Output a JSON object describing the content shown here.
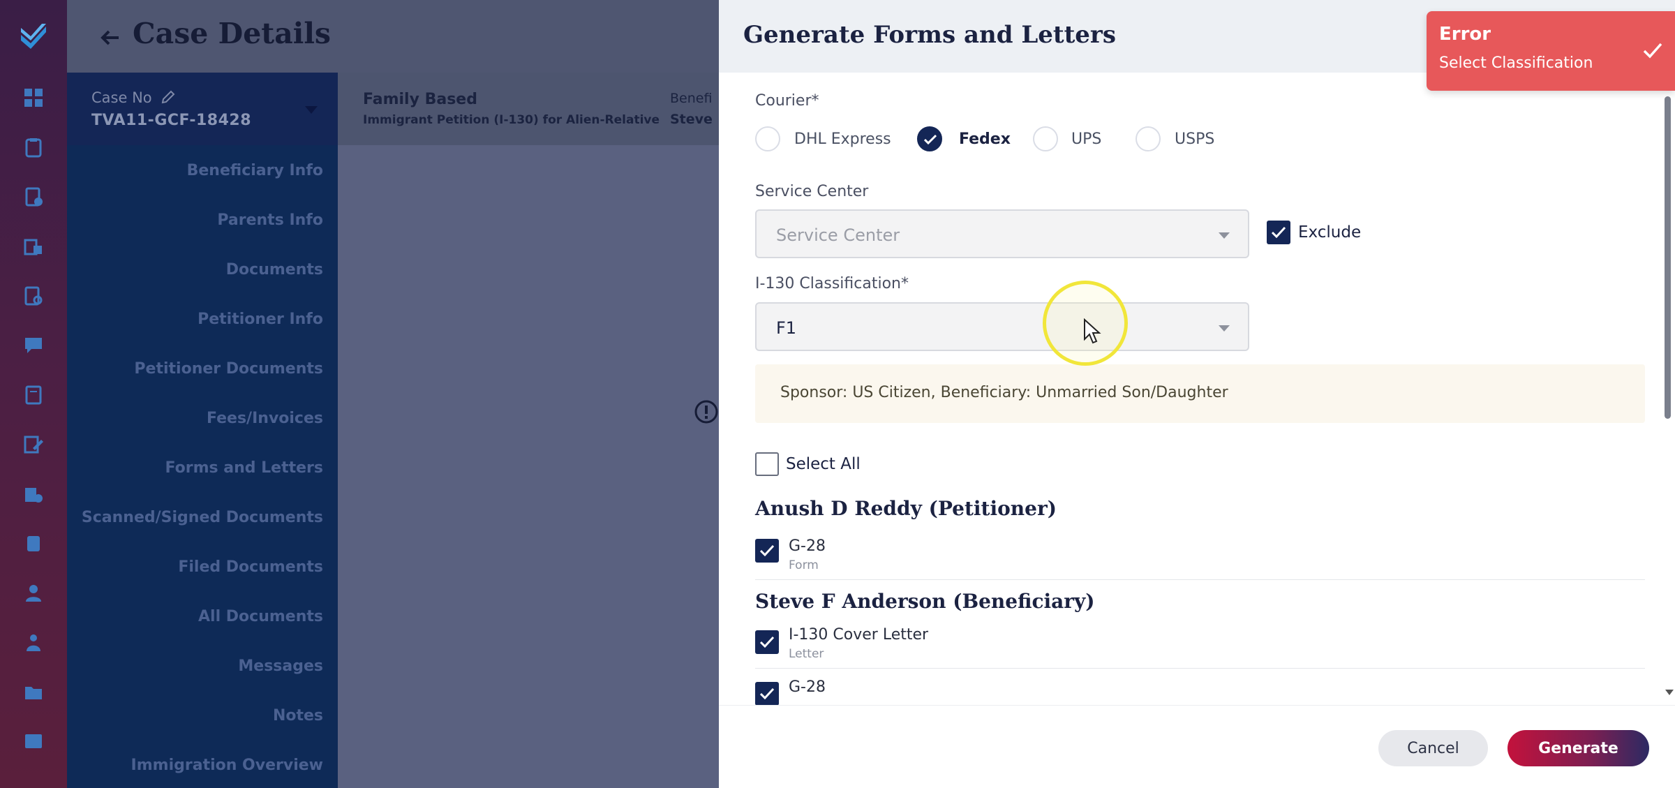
{
  "page": {
    "title": "Case Details",
    "case_no_label": "Case No",
    "case_no_value": "TVA11-GCF-18428",
    "case_type": "Family Based",
    "case_subtype": "Immigrant Petition (I-130) for Alien-Relative",
    "beneficiary_label": "Benefi",
    "beneficiary_value": "Steve"
  },
  "sidebar": {
    "items": [
      {
        "label": "Beneficiary Info"
      },
      {
        "label": "Parents Info"
      },
      {
        "label": "Documents"
      },
      {
        "label": "Petitioner Info"
      },
      {
        "label": "Petitioner Documents"
      },
      {
        "label": "Fees/Invoices"
      },
      {
        "label": "Forms and Letters"
      },
      {
        "label": "Scanned/Signed Documents"
      },
      {
        "label": "Filed Documents"
      },
      {
        "label": "All Documents"
      },
      {
        "label": "Messages"
      },
      {
        "label": "Notes"
      },
      {
        "label": "Immigration Overview"
      }
    ]
  },
  "rail_icons": [
    "logo-icon",
    "dashboard-icon",
    "clipboard-icon",
    "file-check-icon",
    "building-file-icon",
    "document-search-icon",
    "chat-icon",
    "book-icon",
    "edit-file-icon",
    "building-check-icon",
    "badge-icon",
    "user-icon",
    "users-icon",
    "folder-icon",
    "message-icon"
  ],
  "modal": {
    "title": "Generate Forms and Letters",
    "courier": {
      "label": "Courier*",
      "options": [
        "DHL Express",
        "Fedex",
        "UPS",
        "USPS"
      ],
      "selected": "Fedex"
    },
    "service_center": {
      "label": "Service Center",
      "placeholder": "Service Center",
      "exclude_label": "Exclude",
      "exclude_checked": true
    },
    "classification": {
      "label": "I-130 Classification*",
      "value": "F1",
      "hint": "Sponsor: US Citizen, Beneficiary: Unmarried Son/Daughter"
    },
    "select_all_label": "Select All",
    "groups": [
      {
        "title": "Anush D Reddy (Petitioner)",
        "docs": [
          {
            "name": "G-28",
            "type": "Form",
            "checked": true
          }
        ]
      },
      {
        "title": "Steve F Anderson (Beneficiary)",
        "docs": [
          {
            "name": "I-130 Cover Letter",
            "type": "Letter",
            "checked": true
          },
          {
            "name": "G-28",
            "type": "",
            "checked": true
          }
        ]
      }
    ],
    "cancel_label": "Cancel",
    "generate_label": "Generate"
  },
  "toast": {
    "title": "Error",
    "message": "Select Classification",
    "color": "#e7585a"
  },
  "colors": {
    "brand_navy": "#142656",
    "accent_red": "#c3123c"
  }
}
